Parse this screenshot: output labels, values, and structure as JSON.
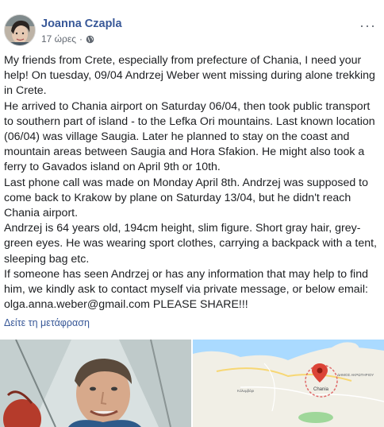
{
  "post": {
    "author": "Joanna Czapla",
    "time": "17 ώρες",
    "separator": "·",
    "privacy_icon": "globe-icon",
    "menu_icon": "more-options-icon",
    "paragraphs": [
      "My friends from Crete, especially from prefecture of Chania, I need your help! On tuesday, 09/04 Andrzej Weber went missing during alone trekking in Crete.",
      "He arrived to Chania airport on Saturday 06/04, then took public transport to southern part of island - to the Lefka Ori mountains. Last known location (06/04) was village Saugia. Later he planned to stay on the coast and mountain areas between Saugia and Hora Sfakion. He might also took a ferry to Gavados island on April 9th or 10th.",
      "Last phone call was made on Monday April 8th. Andrzej was supposed to come back to Krakow by plane on Saturday 13/04, but he didn't reach Chania airport.",
      "Andrzej is 64 years old, 194cm height, slim figure. Short gray hair, grey-green eyes. He was wearing sport clothes, carrying a backpack with a tent, sleeping bag etc.",
      "If someone has seen Andrzej or has any information that may help to find him, we kindly ask to contact myself via private message, or below email: olga.anna.weber@gmail.com PLEASE SHARE!!!"
    ],
    "see_translation": "Δείτε τη μετάφραση",
    "colors": {
      "link": "#385898",
      "text": "#1c1e21",
      "meta": "#616770",
      "map_water": "#aadaff",
      "map_land": "#f1efe6",
      "map_pin": "#db4437"
    },
    "map": {
      "pin_label": "Chania",
      "label_right": "ΔΗΜΟΣ ΑΚΡΩΤΗΡΙΟΥ",
      "label_lower": "Κόλυμβάρι"
    }
  }
}
